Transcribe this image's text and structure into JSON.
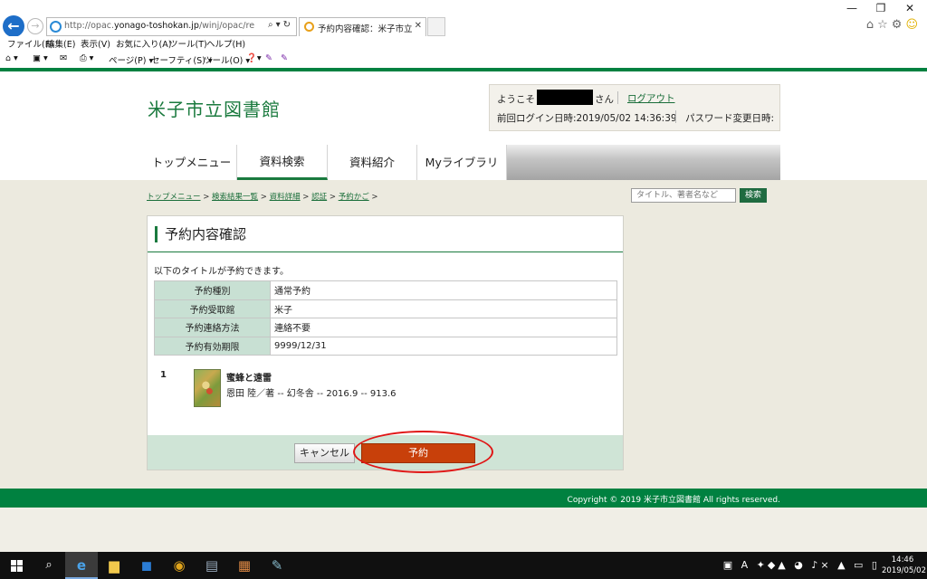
{
  "browser": {
    "url_prefix": "http://opac.",
    "url_domain": "yonago-toshokan.jp",
    "url_path": "/winj/opac/reserve-basket",
    "tab_title": "予約内容確認：米子市立図...",
    "menu": [
      "ファイル(F)",
      "編集(E)",
      "表示(V)",
      "お気に入り(A)",
      "ツール(T)",
      "ヘルプ(H)"
    ],
    "commands": {
      "page": "ページ(P) ▾",
      "safety": "セーフティ(S) ▾",
      "tools": "ツール(O) ▾"
    }
  },
  "site": {
    "title": "米子市立図書館",
    "welcome": "ようこそ",
    "san": "さん",
    "logout": "ログアウト",
    "last_login": "前回ログイン日時:2019/05/02 14:36:39",
    "pw_change": "パスワード変更日時:"
  },
  "nav": [
    "トップメニュー",
    "資料検索",
    "資料紹介",
    "Myライブラリ"
  ],
  "breadcrumb": [
    "トップメニュー",
    "検索結果一覧",
    "資料詳細",
    "認証",
    "予約かご"
  ],
  "search": {
    "placeholder": "タイトル、著者名など",
    "button": "検索"
  },
  "panel": {
    "title": "予約内容確認",
    "intro": "以下のタイトルが予約できます。",
    "rows": [
      {
        "label": "予約種別",
        "value": "通常予約"
      },
      {
        "label": "予約受取館",
        "value": "米子"
      },
      {
        "label": "予約連絡方法",
        "value": "連絡不要"
      },
      {
        "label": "予約有効期限",
        "value": "9999/12/31"
      }
    ],
    "book": {
      "number": "1",
      "title": "蜜蜂と遠雷",
      "meta": "恩田 陸／著 -- 幻冬舎 -- 2016.9 -- 913.6"
    },
    "cancel": "キャンセル",
    "reserve": "予約"
  },
  "footer": {
    "copyright": "Copyright © 2019 米子市立図書館 All rights reserved."
  },
  "taskbar": {
    "time": "14:46",
    "date": "2019/05/02"
  }
}
